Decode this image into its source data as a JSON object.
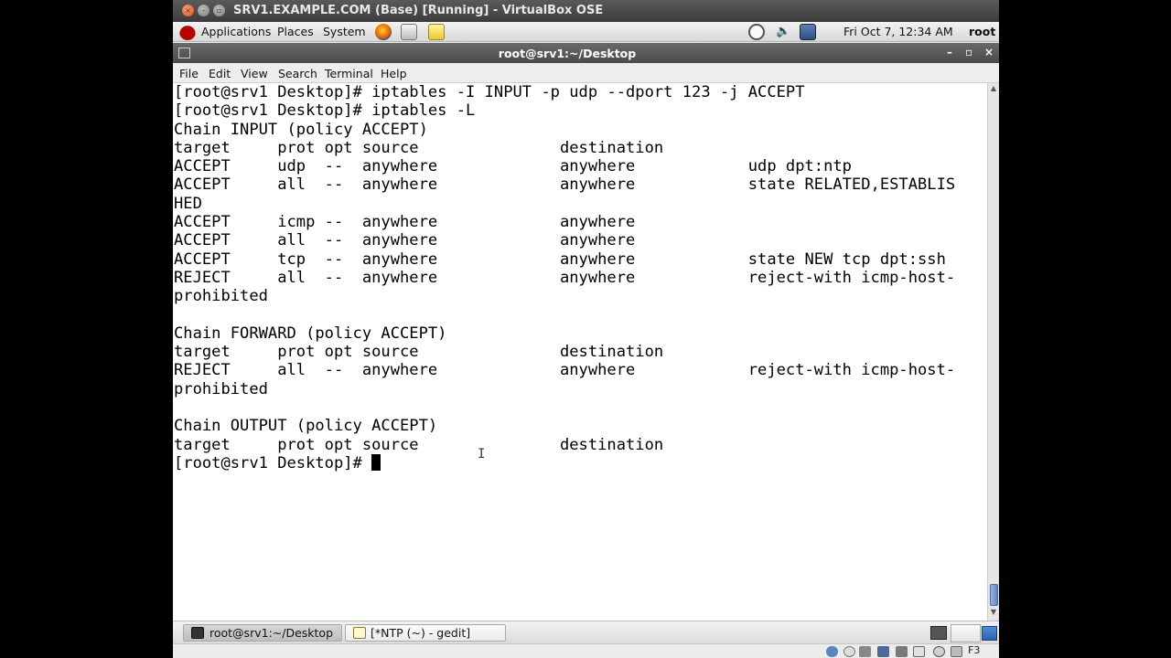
{
  "vbox": {
    "title": "SRV1.EXAMPLE.COM (Base) [Running] - VirtualBox OSE",
    "host_key": "F3"
  },
  "top_panel": {
    "applications": "Applications",
    "places": "Places",
    "system": "System",
    "clock": "Fri Oct  7, 12:34 AM",
    "user": "root"
  },
  "terminal": {
    "title": "root@srv1:~/Desktop",
    "controls": {
      "minimize": "–",
      "maximize": "▫",
      "close": "×"
    },
    "menu": [
      "File",
      "Edit",
      "View",
      "Search",
      "Terminal",
      "Help"
    ],
    "lines": [
      "[root@srv1 Desktop]# iptables -I INPUT -p udp --dport 123 -j ACCEPT",
      "[root@srv1 Desktop]# iptables -L",
      "Chain INPUT (policy ACCEPT)",
      "target     prot opt source               destination",
      "ACCEPT     udp  --  anywhere             anywhere            udp dpt:ntp",
      "ACCEPT     all  --  anywhere             anywhere            state RELATED,ESTABLIS",
      "HED",
      "ACCEPT     icmp --  anywhere             anywhere",
      "ACCEPT     all  --  anywhere             anywhere",
      "ACCEPT     tcp  --  anywhere             anywhere            state NEW tcp dpt:ssh",
      "REJECT     all  --  anywhere             anywhere            reject-with icmp-host-",
      "prohibited",
      "",
      "Chain FORWARD (policy ACCEPT)",
      "target     prot opt source               destination",
      "REJECT     all  --  anywhere             anywhere            reject-with icmp-host-",
      "prohibited",
      "",
      "Chain OUTPUT (policy ACCEPT)",
      "target     prot opt source               destination"
    ],
    "prompt": "[root@srv1 Desktop]# "
  },
  "taskbar": {
    "tasks": [
      "root@srv1:~/Desktop",
      "[*NTP (~) - gedit]"
    ]
  },
  "icons": {
    "redhat": "redhat-logo-icon",
    "firefox": "firefox-icon",
    "mail": "mail-icon",
    "notes": "notes-icon",
    "clock": "clock-icon",
    "volume": "volume-icon",
    "network": "network-icon"
  }
}
